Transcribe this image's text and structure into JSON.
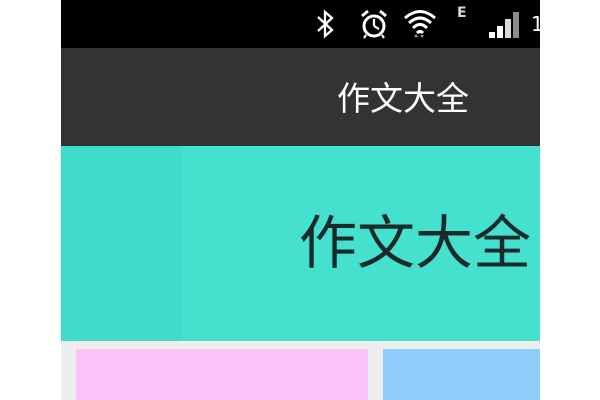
{
  "status_bar": {
    "icons": [
      "bluetooth-icon",
      "alarm-clock-icon",
      "wifi-icon",
      "signal-icon"
    ],
    "network_type": "E",
    "time_partial": "1"
  },
  "action_bar": {
    "title": "作文大全"
  },
  "banner": {
    "title": "作文大全",
    "color": "#43e1ce"
  },
  "tiles": [
    {
      "color": "#fcc3fb"
    },
    {
      "color": "#8fcdfa"
    }
  ]
}
